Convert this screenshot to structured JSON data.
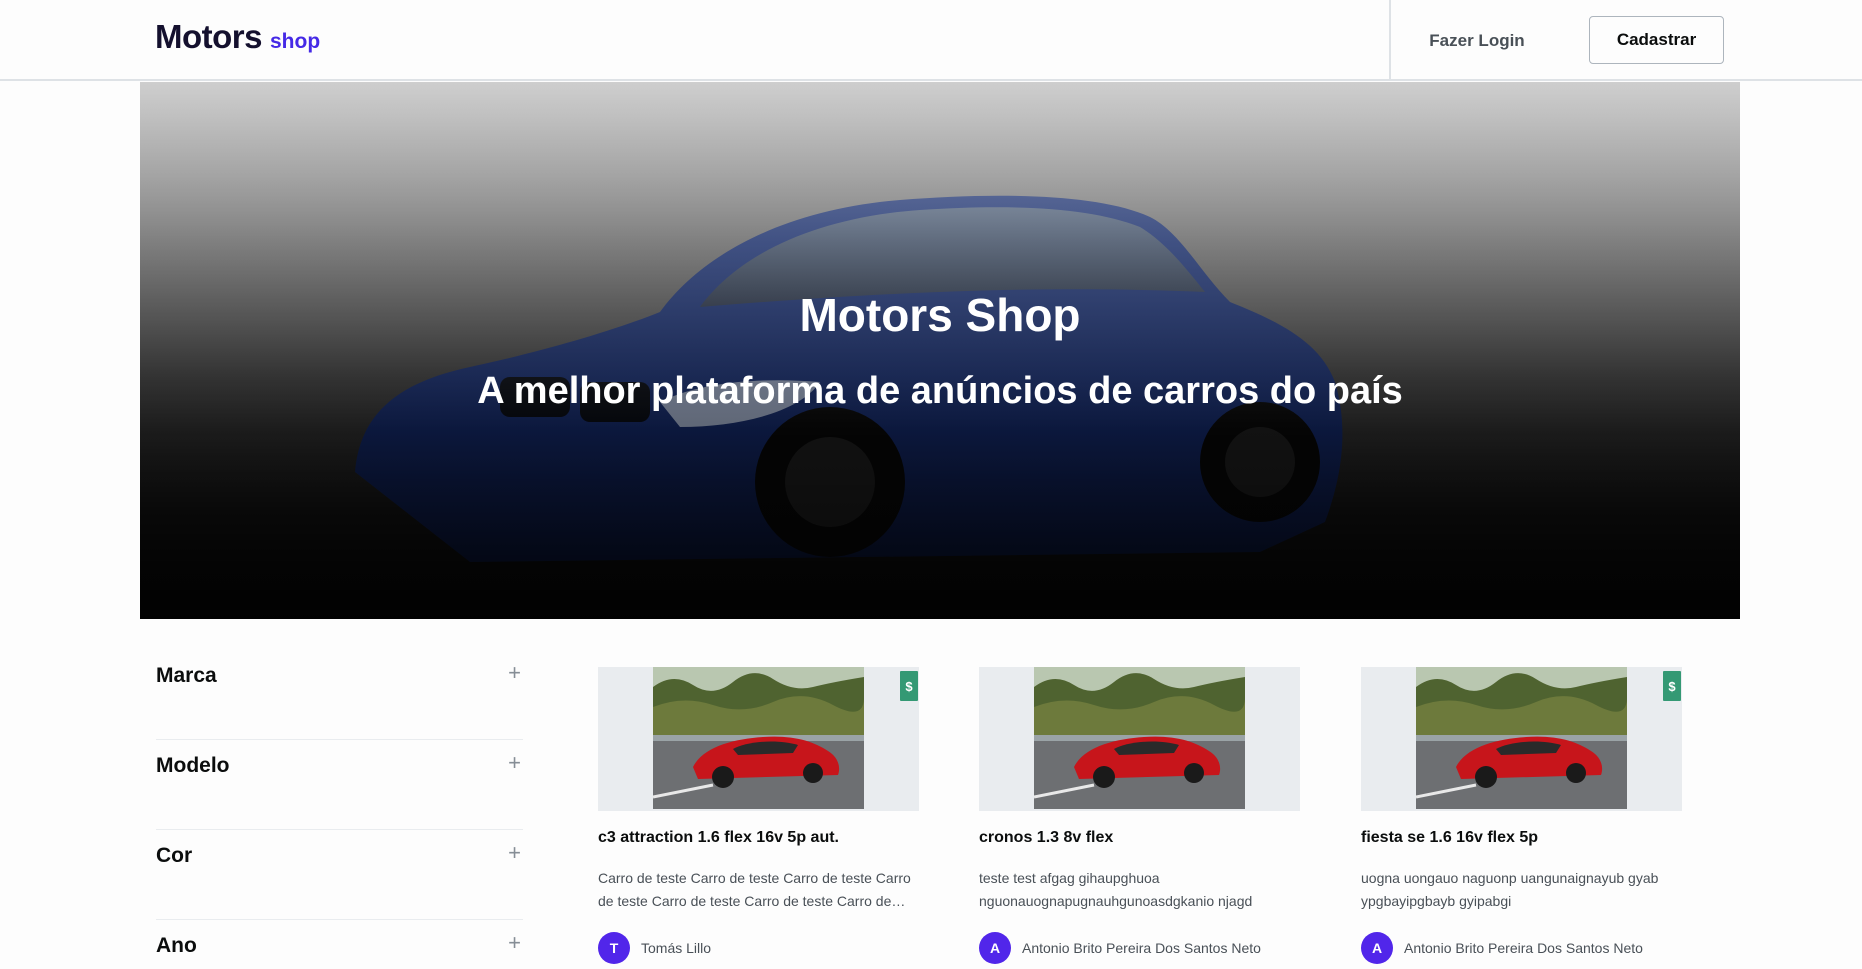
{
  "header": {
    "logo_main": "Motors",
    "logo_sub": "shop",
    "login_label": "Fazer Login",
    "signup_label": "Cadastrar"
  },
  "hero": {
    "title": "Motors Shop",
    "subtitle": "A melhor plataforma de anúncios de carros do país"
  },
  "filters": [
    {
      "label": "Marca"
    },
    {
      "label": "Modelo"
    },
    {
      "label": "Cor"
    },
    {
      "label": "Ano"
    }
  ],
  "cards": [
    {
      "title": "c3 attraction 1.6 flex 16v 5p aut.",
      "description": "Carro de teste Carro de teste Carro de teste Carro de teste Carro de teste Carro de teste Carro de teste",
      "author_initial": "T",
      "author_name": "Tomás Lillo",
      "badge": "$",
      "has_badge": true
    },
    {
      "title": "cronos 1.3 8v flex",
      "description": "teste test afgag gihaupghuoa nguonauognapugnauhgunoasdgkanio njagd",
      "author_initial": "A",
      "author_name": "Antonio Brito Pereira Dos Santos Neto",
      "badge": "",
      "has_badge": false
    },
    {
      "title": "fiesta se 1.6 16v flex 5p",
      "description": "uogna uongauo naguonp uangunaignayub gyab ypgbayipgbayb gyipabgi",
      "author_initial": "A",
      "author_name": "Antonio Brito Pereira Dos Santos Neto",
      "badge": "$",
      "has_badge": true
    }
  ],
  "colors": {
    "brand": "#4529e6",
    "avatar": "#5126ea",
    "badge": "#349974"
  }
}
